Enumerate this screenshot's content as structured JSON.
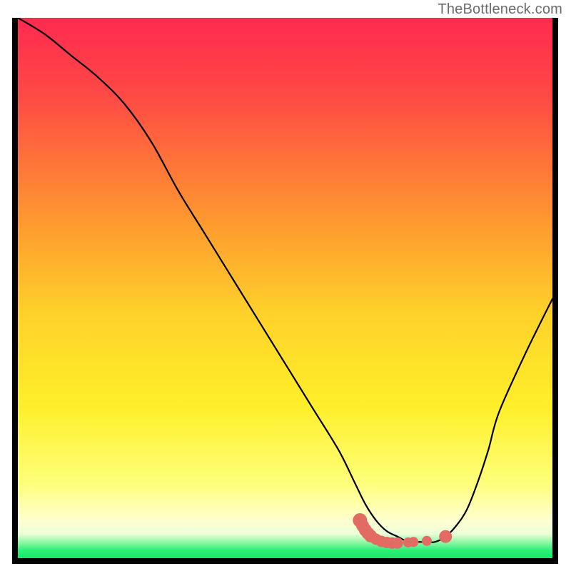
{
  "watermark": "TheBottleneck.com",
  "chart_data": {
    "type": "line",
    "title": "",
    "xlabel": "",
    "ylabel": "",
    "xlim": [
      0,
      100
    ],
    "ylim": [
      0,
      100
    ],
    "background_gradient": {
      "top": "#ff2a4f",
      "upper_mid": "#ffb82d",
      "mid": "#ffe92d",
      "lower": "#ffff8a",
      "bottom_band": "#2df07a"
    },
    "series": [
      {
        "name": "curve",
        "color": "#000000",
        "x": [
          0,
          5,
          10,
          15,
          20,
          25,
          30,
          35,
          40,
          45,
          50,
          55,
          60,
          63,
          65,
          67,
          69,
          71,
          73,
          74,
          76,
          78,
          80,
          82,
          84,
          86,
          88,
          90,
          95,
          100
        ],
        "y": [
          100,
          97,
          93,
          89,
          84,
          77,
          68,
          60,
          52,
          44,
          36,
          28,
          20,
          14,
          10,
          7,
          5,
          4,
          3,
          3,
          3,
          3,
          4,
          6,
          9,
          14,
          20,
          27,
          38,
          48
        ]
      }
    ],
    "markers": {
      "name": "highlight-segment",
      "color": "#e26b63",
      "points": [
        {
          "x": 64.0,
          "y": 7.0
        },
        {
          "x": 64.5,
          "y": 6.0
        },
        {
          "x": 65.0,
          "y": 5.2
        },
        {
          "x": 65.5,
          "y": 4.6
        },
        {
          "x": 66.0,
          "y": 4.1
        },
        {
          "x": 67.0,
          "y": 3.5
        },
        {
          "x": 68.0,
          "y": 3.1
        },
        {
          "x": 69.0,
          "y": 2.9
        },
        {
          "x": 70.0,
          "y": 2.8
        },
        {
          "x": 71.0,
          "y": 2.8
        },
        {
          "x": 73.0,
          "y": 2.9
        },
        {
          "x": 74.0,
          "y": 3.0
        },
        {
          "x": 76.5,
          "y": 3.2
        },
        {
          "x": 80.0,
          "y": 4.0
        }
      ]
    }
  }
}
